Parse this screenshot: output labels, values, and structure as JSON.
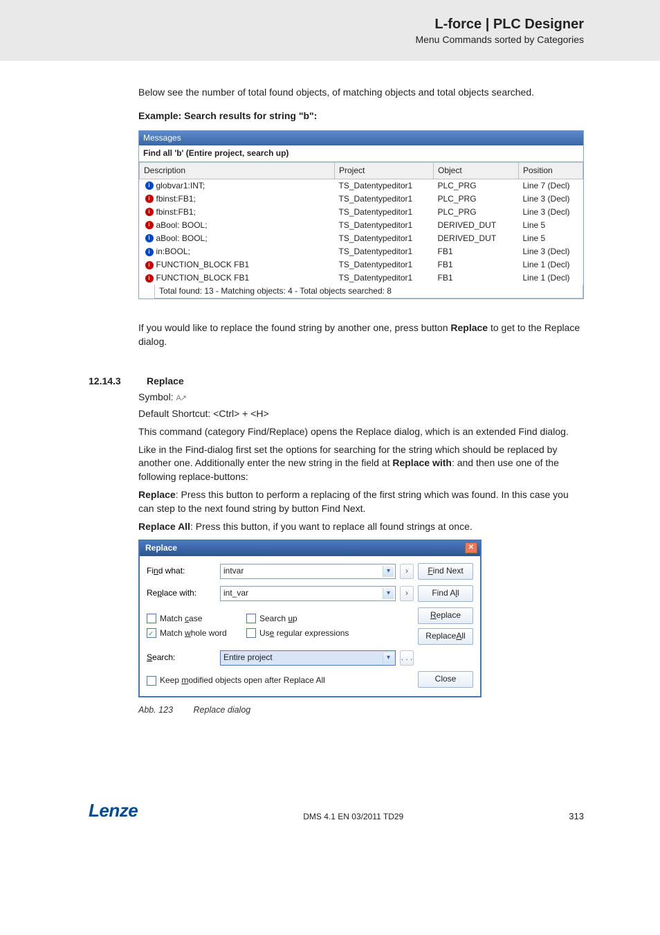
{
  "header": {
    "title": "L-force | PLC Designer",
    "subtitle": "Menu Commands sorted by Categories"
  },
  "intro": "Below see the number of total found objects, of matching objects and total objects searched.",
  "example_caption": "Example: Search results for string \"b\":",
  "messages_panel": {
    "title": "Messages",
    "filter": "Find all 'b' (Entire project, search up)",
    "columns": {
      "c1": "Description",
      "c2": "Project",
      "c3": "Object",
      "c4": "Position"
    },
    "rows": [
      {
        "icon": "blue",
        "desc": "globvar1:INT;",
        "proj": "TS_Datentypeditor1",
        "obj": "PLC_PRG",
        "pos": "Line 7 (Decl)"
      },
      {
        "icon": "red",
        "desc": "fbinst:FB1;",
        "proj": "TS_Datentypeditor1",
        "obj": "PLC_PRG",
        "pos": "Line 3 (Decl)"
      },
      {
        "icon": "red",
        "desc": "fbinst:FB1;",
        "proj": "TS_Datentypeditor1",
        "obj": "PLC_PRG",
        "pos": "Line 3 (Decl)"
      },
      {
        "icon": "red",
        "desc": "aBool: BOOL;",
        "proj": "TS_Datentypeditor1",
        "obj": "DERIVED_DUT",
        "pos": "Line 5"
      },
      {
        "icon": "blue",
        "desc": "aBool: BOOL;",
        "proj": "TS_Datentypeditor1",
        "obj": "DERIVED_DUT",
        "pos": "Line 5"
      },
      {
        "icon": "blue",
        "desc": "in:BOOL;",
        "proj": "TS_Datentypeditor1",
        "obj": "FB1",
        "pos": "Line 3 (Decl)"
      },
      {
        "icon": "red",
        "desc": "FUNCTION_BLOCK FB1",
        "proj": "TS_Datentypeditor1",
        "obj": "FB1",
        "pos": "Line 1 (Decl)"
      },
      {
        "icon": "red",
        "desc": "FUNCTION_BLOCK FB1",
        "proj": "TS_Datentypeditor1",
        "obj": "FB1",
        "pos": "Line 1 (Decl)"
      }
    ],
    "footer": "Total found: 13 - Matching objects: 4 - Total objects searched: 8"
  },
  "replace_note_pre": "If you would like to replace the found string by another one, press button ",
  "replace_note_bold": "Replace",
  "replace_note_post": " to get to the Replace dialog.",
  "section": {
    "num": "12.14.3",
    "title": "Replace",
    "symbol_label": "Symbol: ",
    "shortcut": "Default Shortcut: <Ctrl> + <H>",
    "p1": "This command (category Find/Replace) opens the Replace dialog, which is an extended Find dialog.",
    "p2_pre": "Like in the Find-dialog first set the options for searching for the string which should be replaced by another one. Additionally enter the new string in the field at ",
    "p2_bold": "Replace with",
    "p2_post": ": and then use one of the following replace-buttons:",
    "p3_bold": "Replace",
    "p3_post": ": Press this button to perform a replacing of the first string which was found. In this case you can step to the next found string by button Find Next.",
    "p4_bold": "Replace All",
    "p4_post": ": Press this button, if you want to replace all found strings at once."
  },
  "dialog": {
    "title": "Replace",
    "find_what_label": "Find what:",
    "find_what_value": "intvar",
    "replace_with_label": "Replace with:",
    "replace_with_value": "int_var",
    "match_case": "Match case",
    "match_whole": "Match whole word",
    "search_up": "Search up",
    "use_regex": "Use regular expressions",
    "search_label": "Search:",
    "search_value": "Entire project",
    "keep_modified": "Keep modified objects open after Replace All",
    "btn_find_next": "Find Next",
    "btn_find_all": "Find All",
    "btn_replace": "Replace",
    "btn_replace_all": "Replace All",
    "btn_close": "Close",
    "ellipsis": ". . ."
  },
  "figure_caption": {
    "abb": "Abb. 123",
    "text": "Replace dialog"
  },
  "footer": {
    "logo": "Lenze",
    "mid": "DMS 4.1 EN 03/2011 TD29",
    "page": "313"
  }
}
